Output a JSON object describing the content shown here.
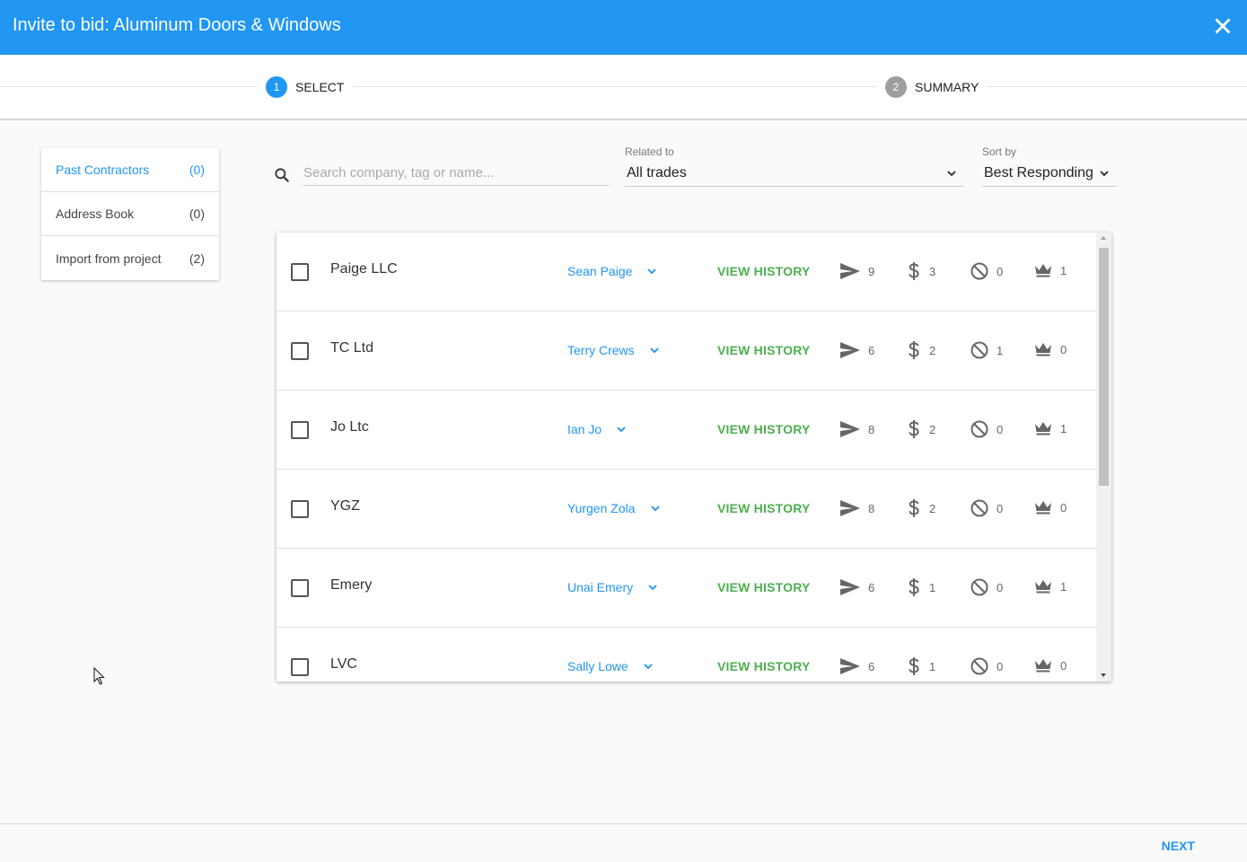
{
  "header": {
    "title": "Invite to bid: Aluminum Doors & Windows"
  },
  "stepper": {
    "steps": [
      {
        "number": "1",
        "label": "SELECT"
      },
      {
        "number": "2",
        "label": "SUMMARY"
      }
    ]
  },
  "sidebar": {
    "items": [
      {
        "label": "Past Contractors",
        "count": "(0)"
      },
      {
        "label": "Address Book",
        "count": "(0)"
      },
      {
        "label": "Import from project",
        "count": "(2)"
      }
    ]
  },
  "search": {
    "placeholder": "Search company, tag or name..."
  },
  "filters": {
    "related_label": "Related to",
    "related_value": "All trades",
    "sort_label": "Sort by",
    "sort_value": "Best Responding"
  },
  "table": {
    "history_label": "VIEW HISTORY",
    "rows": [
      {
        "company": "Paige LLC",
        "contact": "Sean Paige",
        "sent": "9",
        "bids": "3",
        "declined": "0",
        "won": "1"
      },
      {
        "company": "TC Ltd",
        "contact": "Terry Crews",
        "sent": "6",
        "bids": "2",
        "declined": "1",
        "won": "0"
      },
      {
        "company": "Jo Ltc",
        "contact": "Ian Jo",
        "sent": "8",
        "bids": "2",
        "declined": "0",
        "won": "1"
      },
      {
        "company": "YGZ",
        "contact": "Yurgen Zola",
        "sent": "8",
        "bids": "2",
        "declined": "0",
        "won": "0"
      },
      {
        "company": "Emery",
        "contact": "Unai Emery",
        "sent": "6",
        "bids": "1",
        "declined": "0",
        "won": "1"
      },
      {
        "company": "LVC",
        "contact": "Sally Lowe",
        "sent": "6",
        "bids": "1",
        "declined": "0",
        "won": "0"
      }
    ]
  },
  "footer": {
    "next_label": "NEXT"
  },
  "icons": {
    "close": "close-icon",
    "search": "search-icon",
    "dropdown": "chevron-down-icon",
    "sent": "send-icon",
    "bids": "dollar-icon",
    "declined": "block-icon",
    "won": "crown-icon"
  },
  "colors": {
    "primary": "#2196f3",
    "success": "#4caf50",
    "step_inactive": "#9e9e9e"
  }
}
